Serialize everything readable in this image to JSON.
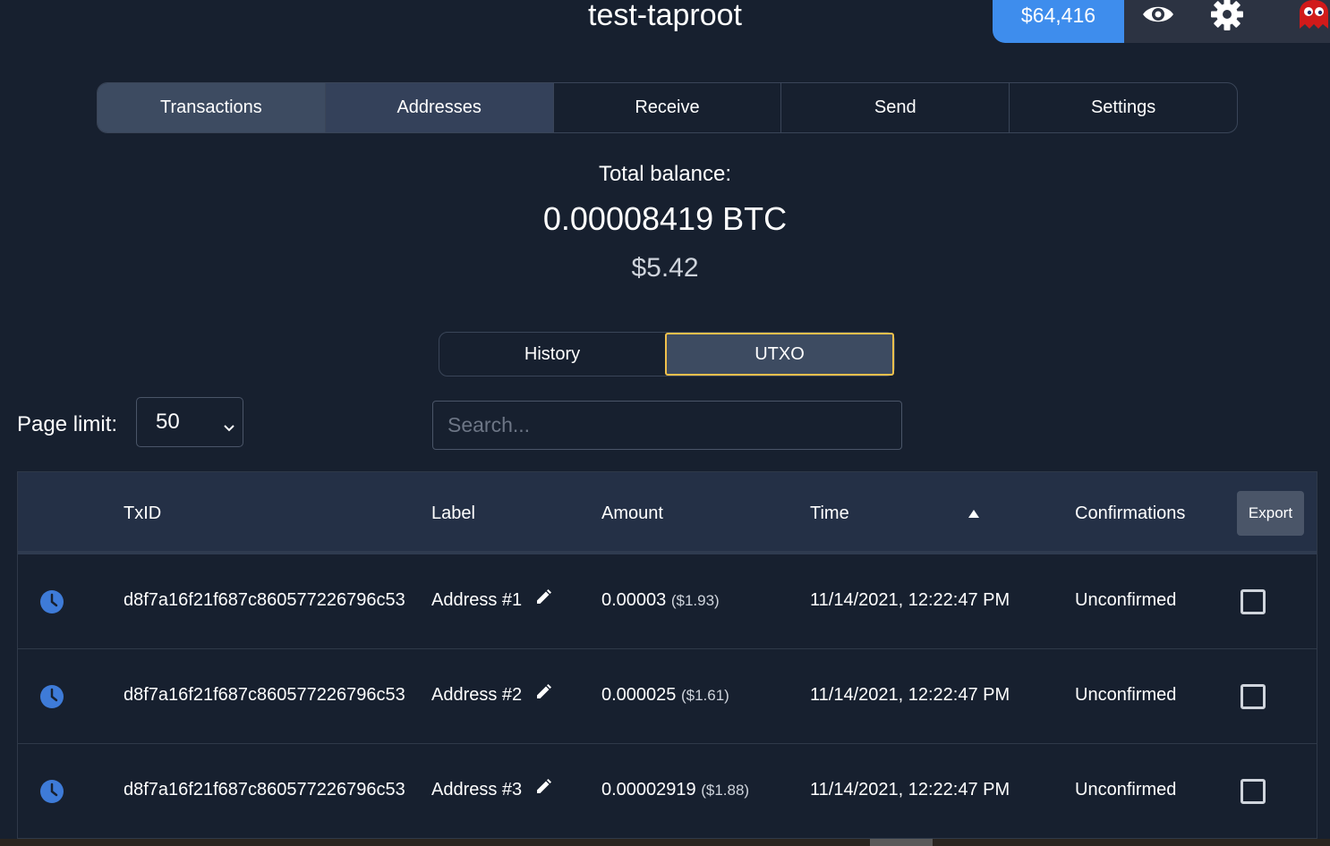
{
  "wallet": {
    "title": "test-taproot"
  },
  "topbar": {
    "price": "$64,416",
    "icons": [
      "eye-icon",
      "gear-icon",
      "ghost-avatar-icon"
    ]
  },
  "main_tabs": [
    {
      "label": "Transactions"
    },
    {
      "label": "Addresses"
    },
    {
      "label": "Receive"
    },
    {
      "label": "Send"
    },
    {
      "label": "Settings"
    }
  ],
  "balance": {
    "label": "Total balance:",
    "btc": "0.00008419 BTC",
    "usd": "$5.42"
  },
  "sub_tabs": [
    {
      "label": "History"
    },
    {
      "label": "UTXO"
    }
  ],
  "controls": {
    "page_limit_label": "Page limit:",
    "page_limit_value": "50",
    "search_placeholder": "Search..."
  },
  "table": {
    "headers": {
      "txid": "TxID",
      "label": "Label",
      "amount": "Amount",
      "time": "Time",
      "confirmations": "Confirmations",
      "export": "Export"
    },
    "rows": [
      {
        "txid": "d8f7a16f21f687c860577226796c53",
        "label": "Address #1",
        "amount": "0.00003",
        "amount_usd": "($1.93)",
        "time": "11/14/2021, 12:22:47 PM",
        "confirmations": "Unconfirmed"
      },
      {
        "txid": "d8f7a16f21f687c860577226796c53",
        "label": "Address #2",
        "amount": "0.000025",
        "amount_usd": "($1.61)",
        "time": "11/14/2021, 12:22:47 PM",
        "confirmations": "Unconfirmed"
      },
      {
        "txid": "d8f7a16f21f687c860577226796c53",
        "label": "Address #3",
        "amount": "0.00002919",
        "amount_usd": "($1.88)",
        "time": "11/14/2021, 12:22:47 PM",
        "confirmations": "Unconfirmed"
      }
    ]
  },
  "colors": {
    "background": "#17202f",
    "accent": "#3e8ded",
    "active_outline": "#f0c04c",
    "clock": "#3e7bd8"
  }
}
